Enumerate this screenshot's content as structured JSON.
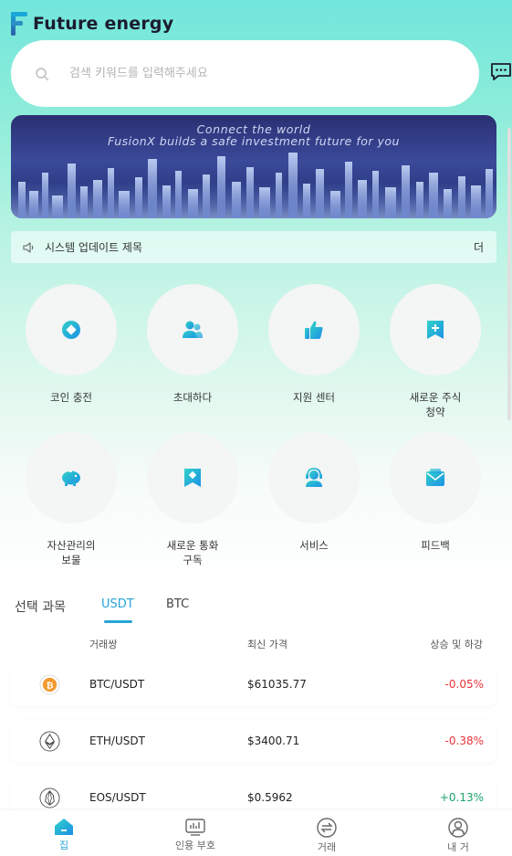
{
  "header": {
    "brand": "Future energy"
  },
  "search": {
    "placeholder": "검색 키워드를 입력해주세요"
  },
  "banner": {
    "line1": "Connect the world",
    "line2": "FusionX builds a safe investment future for you"
  },
  "notice": {
    "text": "시스템 업데이트 제목",
    "more": "더"
  },
  "menu": [
    {
      "label": "코인 충전",
      "icon": "coin-deposit-icon"
    },
    {
      "label": "초대하다",
      "icon": "invite-users-icon"
    },
    {
      "label": "지원 센터",
      "icon": "thumbs-up-icon"
    },
    {
      "label": "새로운 주식 청약",
      "icon": "bookmark-plus-icon"
    },
    {
      "label": "자산관리의 보물",
      "icon": "piggy-bank-icon"
    },
    {
      "label": "새로운 통화 구독",
      "icon": "bookmark-diamond-icon"
    },
    {
      "label": "서비스",
      "icon": "headset-agent-icon"
    },
    {
      "label": "피드백",
      "icon": "mail-feedback-icon"
    }
  ],
  "market": {
    "title": "선택 과목",
    "tabs": [
      "USDT",
      "BTC"
    ],
    "columns": [
      "거래쌍",
      "최신 가격",
      "상승 및 하강"
    ],
    "rows": [
      {
        "pair": "BTC/USDT",
        "price": "$61035.77",
        "change": "-0.05%",
        "icon": "bitcoin-icon"
      },
      {
        "pair": "ETH/USDT",
        "price": "$3400.71",
        "change": "-0.38%",
        "icon": "ethereum-icon"
      },
      {
        "pair": "EOS/USDT",
        "price": "$0.5962",
        "change": "+0.13%",
        "icon": "eos-icon"
      }
    ]
  },
  "nav": [
    {
      "label": "집",
      "icon": "home-icon",
      "active": true
    },
    {
      "label": "인용 부호",
      "icon": "quotes-chart-icon"
    },
    {
      "label": "거래",
      "icon": "exchange-icon"
    },
    {
      "label": "내 거",
      "icon": "user-icon"
    }
  ],
  "colors": {
    "accent": "#27a5d6",
    "down": "#e8333a",
    "up": "#1aa36b"
  }
}
